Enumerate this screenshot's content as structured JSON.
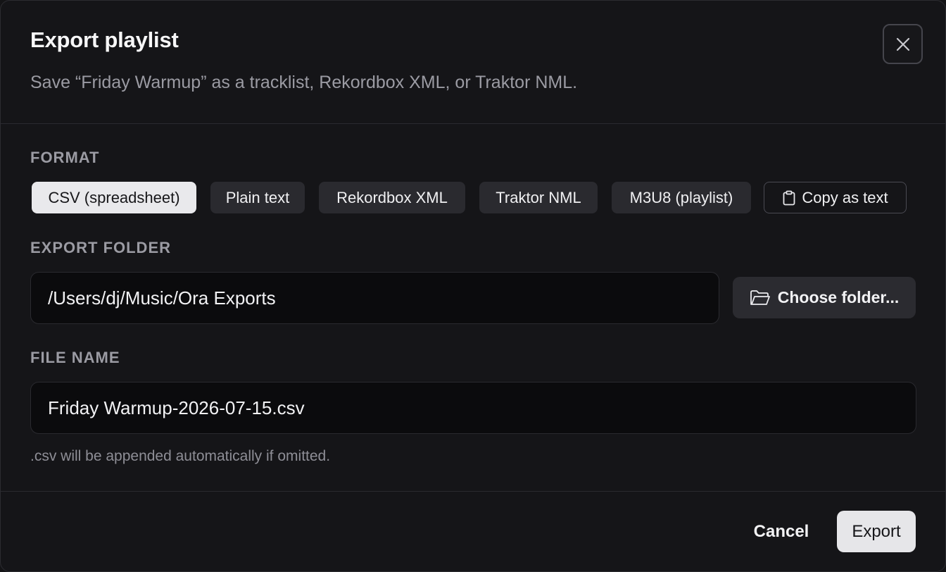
{
  "dialog": {
    "title": "Export playlist",
    "subtitle": "Save “Friday Warmup” as a tracklist, Rekordbox XML, or Traktor NML.",
    "close_icon": "close-icon"
  },
  "format": {
    "label": "FORMAT",
    "options": [
      {
        "label": "CSV (spreadsheet)",
        "selected": true
      },
      {
        "label": "Plain text",
        "selected": false
      },
      {
        "label": "Rekordbox XML",
        "selected": false
      },
      {
        "label": "Traktor NML",
        "selected": false
      },
      {
        "label": "M3U8 (playlist)",
        "selected": false
      }
    ],
    "copy_label": "Copy as text",
    "copy_icon": "clipboard-icon"
  },
  "export_folder": {
    "label": "EXPORT FOLDER",
    "value": "/Users/dj/Music/Ora Exports",
    "choose_label": "Choose folder...",
    "choose_icon": "folder-open-icon"
  },
  "file_name": {
    "label": "FILE NAME",
    "value": "Friday Warmup-2026-07-15.csv",
    "hint": ".csv will be appended automatically if omitted."
  },
  "footer": {
    "cancel_label": "Cancel",
    "export_label": "Export"
  },
  "colors": {
    "background": "#151518",
    "accent_selected": "#e9e9ec",
    "chip": "#2a2a2f",
    "muted_text": "#9b9ba3"
  }
}
